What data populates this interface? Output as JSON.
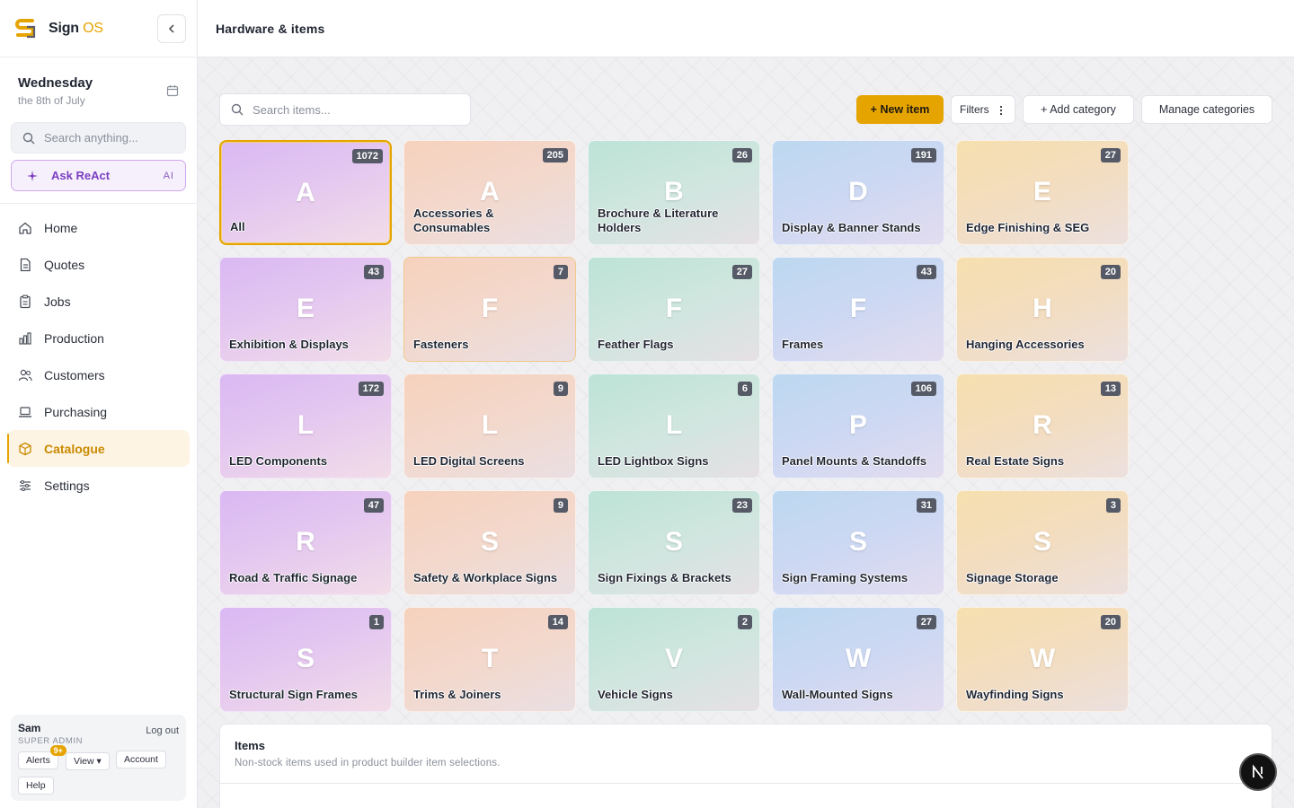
{
  "brand": {
    "name": "Sign",
    "suffix": "OS"
  },
  "date": {
    "day": "Wednesday",
    "sub": "the 8th of July"
  },
  "sidebar": {
    "search_placeholder": "Search anything...",
    "ask": {
      "label": "Ask ReAct",
      "tag": "AI"
    },
    "items": [
      {
        "label": "Home",
        "icon": "home-icon"
      },
      {
        "label": "Quotes",
        "icon": "document-icon"
      },
      {
        "label": "Jobs",
        "icon": "clipboard-icon"
      },
      {
        "label": "Production",
        "icon": "bar-chart-icon"
      },
      {
        "label": "Customers",
        "icon": "users-icon"
      },
      {
        "label": "Purchasing",
        "icon": "laptop-icon"
      },
      {
        "label": "Catalogue",
        "icon": "cube-icon",
        "active": true
      },
      {
        "label": "Settings",
        "icon": "sliders-icon"
      }
    ]
  },
  "user": {
    "name": "Sam",
    "role": "SUPER ADMIN",
    "logout": "Log out",
    "alerts": "Alerts",
    "alerts_badge": "9+",
    "view": "View ▾",
    "account": "Account",
    "help": "Help"
  },
  "header": {
    "title": "Hardware & items"
  },
  "toolbar": {
    "search_placeholder": "Search items...",
    "new_item": "+ New item",
    "filters": "Filters",
    "add_category": "+ Add category",
    "manage_categories": "Manage categories"
  },
  "categories": [
    {
      "letter": "A",
      "name": "All",
      "count": "1072"
    },
    {
      "letter": "A",
      "name": "Accessories & Consumables",
      "count": "205"
    },
    {
      "letter": "B",
      "name": "Brochure & Literature Holders",
      "count": "26"
    },
    {
      "letter": "D",
      "name": "Display & Banner Stands",
      "count": "191"
    },
    {
      "letter": "E",
      "name": "Edge Finishing & SEG",
      "count": "27"
    },
    {
      "letter": "E",
      "name": "Exhibition & Displays",
      "count": "43"
    },
    {
      "letter": "F",
      "name": "Fasteners",
      "count": "7"
    },
    {
      "letter": "F",
      "name": "Feather Flags",
      "count": "27"
    },
    {
      "letter": "F",
      "name": "Frames",
      "count": "43"
    },
    {
      "letter": "H",
      "name": "Hanging Accessories",
      "count": "20"
    },
    {
      "letter": "L",
      "name": "LED Components",
      "count": "172"
    },
    {
      "letter": "L",
      "name": "LED Digital Screens",
      "count": "9"
    },
    {
      "letter": "L",
      "name": "LED Lightbox Signs",
      "count": "6"
    },
    {
      "letter": "P",
      "name": "Panel Mounts & Standoffs",
      "count": "106"
    },
    {
      "letter": "R",
      "name": "Real Estate Signs",
      "count": "13"
    },
    {
      "letter": "R",
      "name": "Road & Traffic Signage",
      "count": "47"
    },
    {
      "letter": "S",
      "name": "Safety & Workplace Signs",
      "count": "9"
    },
    {
      "letter": "S",
      "name": "Sign Fixings & Brackets",
      "count": "23"
    },
    {
      "letter": "S",
      "name": "Sign Framing Systems",
      "count": "31"
    },
    {
      "letter": "S",
      "name": "Signage Storage",
      "count": "3"
    },
    {
      "letter": "S",
      "name": "Structural Sign Frames",
      "count": "1"
    },
    {
      "letter": "T",
      "name": "Trims & Joiners",
      "count": "14"
    },
    {
      "letter": "V",
      "name": "Vehicle Signs",
      "count": "2"
    },
    {
      "letter": "W",
      "name": "Wall-Mounted Signs",
      "count": "27"
    },
    {
      "letter": "W",
      "name": "Wayfinding Signs",
      "count": "20"
    }
  ],
  "items_panel": {
    "title": "Items",
    "subtitle": "Non-stock items used in product builder item selections."
  },
  "fab": {
    "label": "N"
  },
  "colors": {
    "accent": "#e6a400",
    "ask_purple": "#7a3fc1"
  }
}
